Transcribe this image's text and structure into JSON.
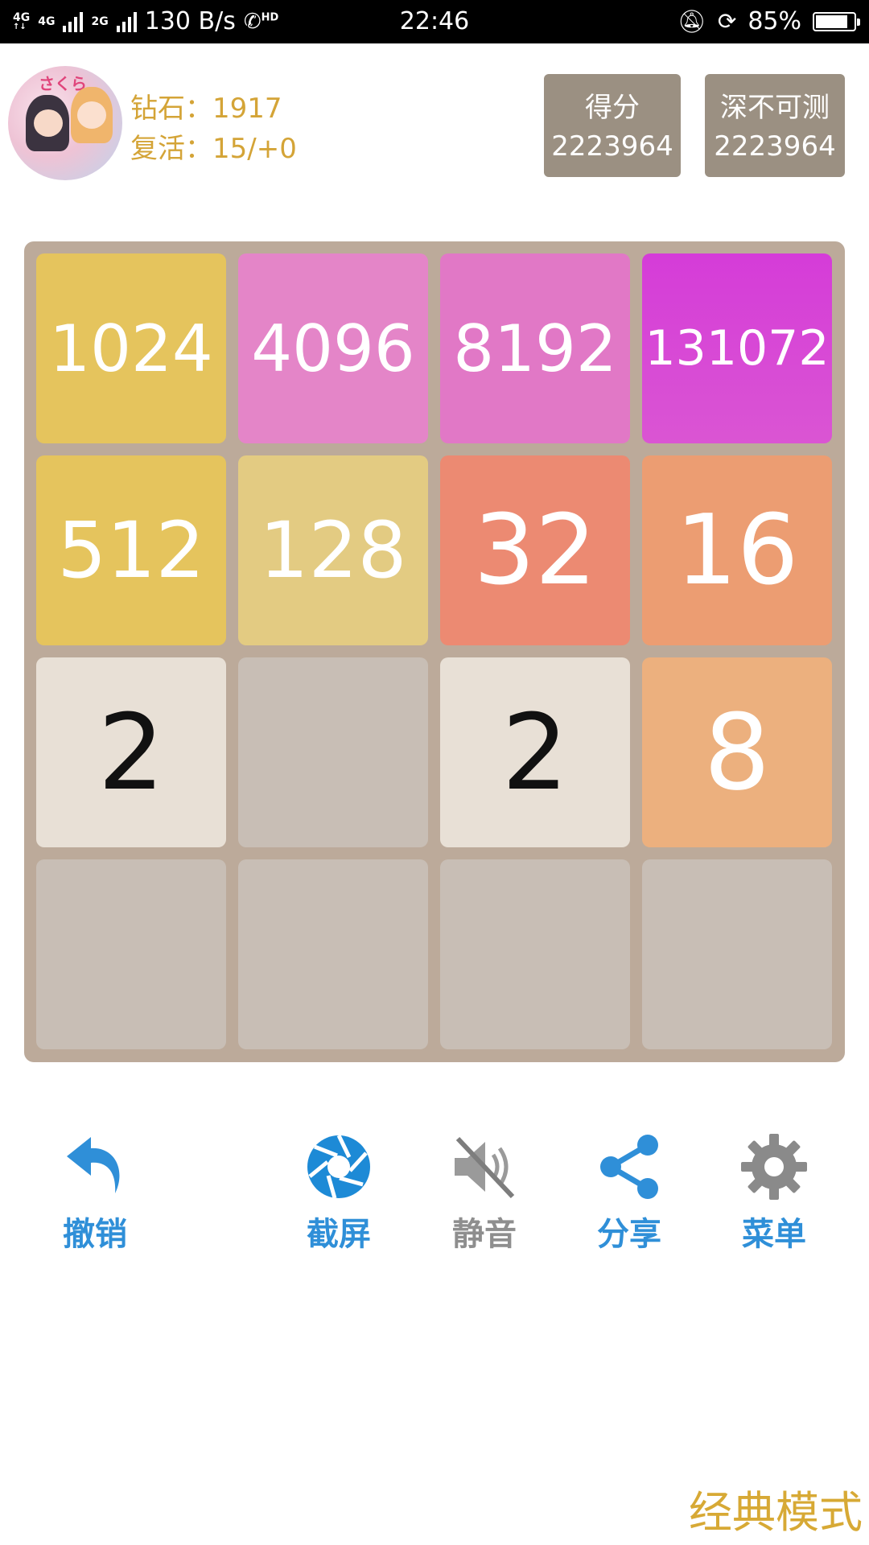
{
  "status_bar": {
    "network_label_1": "4G",
    "network_label_2": "4G",
    "network_label_3": "2G",
    "speed": "130 B/s",
    "call_label": "HD",
    "time": "22:46",
    "battery_percent": "85%",
    "battery_level": 0.85
  },
  "header": {
    "avatar_text": "さくら",
    "diamonds": "钻石：1917",
    "revives": "复活：15/+0",
    "score_label": "得分",
    "score_value": "2223964",
    "best_label": "深不可测",
    "best_value": "2223964"
  },
  "board": {
    "rows": [
      [
        "1024",
        "4096",
        "8192",
        "131072"
      ],
      [
        "512",
        "128",
        "32",
        "16"
      ],
      [
        "2",
        "",
        "2",
        "8"
      ],
      [
        "",
        "",
        "",
        ""
      ]
    ]
  },
  "toolbar": {
    "undo_label": "撤销",
    "screenshot_label": "截屏",
    "mute_label": "静音",
    "share_label": "分享",
    "menu_label": "菜单"
  },
  "mode_label": "经典模式",
  "colors": {
    "accent": "#d4a437",
    "toolbar_blue": "#2f8fd8",
    "toolbar_gray": "#8e8e8e",
    "board_bg": "#bcaa9a",
    "empty_cell": "#c8beb5"
  }
}
